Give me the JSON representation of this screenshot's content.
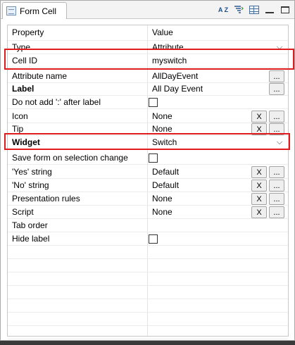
{
  "tab": {
    "title": "Form Cell",
    "icon": "form-cell-icon"
  },
  "toolbar": {
    "sort_label": "A Z",
    "items": [
      "sort-alpha-icon",
      "filter-advanced-icon",
      "table-view-icon",
      "minimize-icon",
      "maximize-icon"
    ]
  },
  "grid": {
    "header": {
      "property": "Property",
      "value": "Value"
    },
    "rows": [
      {
        "name": "Type",
        "value": "Attribute",
        "kind": "combo"
      },
      {
        "name": "Cell ID",
        "value": "myswitch",
        "kind": "text"
      },
      {
        "name": "Attribute name",
        "value": "AllDayEvent",
        "kind": "browse"
      },
      {
        "name": "Label",
        "value": "All Day Event",
        "kind": "browse",
        "bold": true
      },
      {
        "name": "Do not add ':' after label",
        "value": "",
        "kind": "checkbox",
        "checked": false
      },
      {
        "name": "Icon",
        "value": "None",
        "kind": "clear-browse"
      },
      {
        "name": "Tip",
        "value": "None",
        "kind": "clear-browse"
      },
      {
        "name": "Widget",
        "value": "Switch",
        "kind": "combo",
        "bold": true
      },
      {
        "name": "Save form on selection change",
        "value": "",
        "kind": "checkbox",
        "checked": false
      },
      {
        "name": "'Yes' string",
        "value": "Default",
        "kind": "clear-browse"
      },
      {
        "name": "'No' string",
        "value": "Default",
        "kind": "clear-browse"
      },
      {
        "name": "Presentation rules",
        "value": "None",
        "kind": "clear-browse"
      },
      {
        "name": "Script",
        "value": "None",
        "kind": "clear-browse"
      },
      {
        "name": "Tab order",
        "value": "",
        "kind": "text"
      },
      {
        "name": "Hide label",
        "value": "",
        "kind": "checkbox",
        "checked": false
      }
    ],
    "clear_label": "X",
    "browse_label": "...",
    "combo_arrow": "⌵"
  },
  "highlight_color": "#e01b1b"
}
